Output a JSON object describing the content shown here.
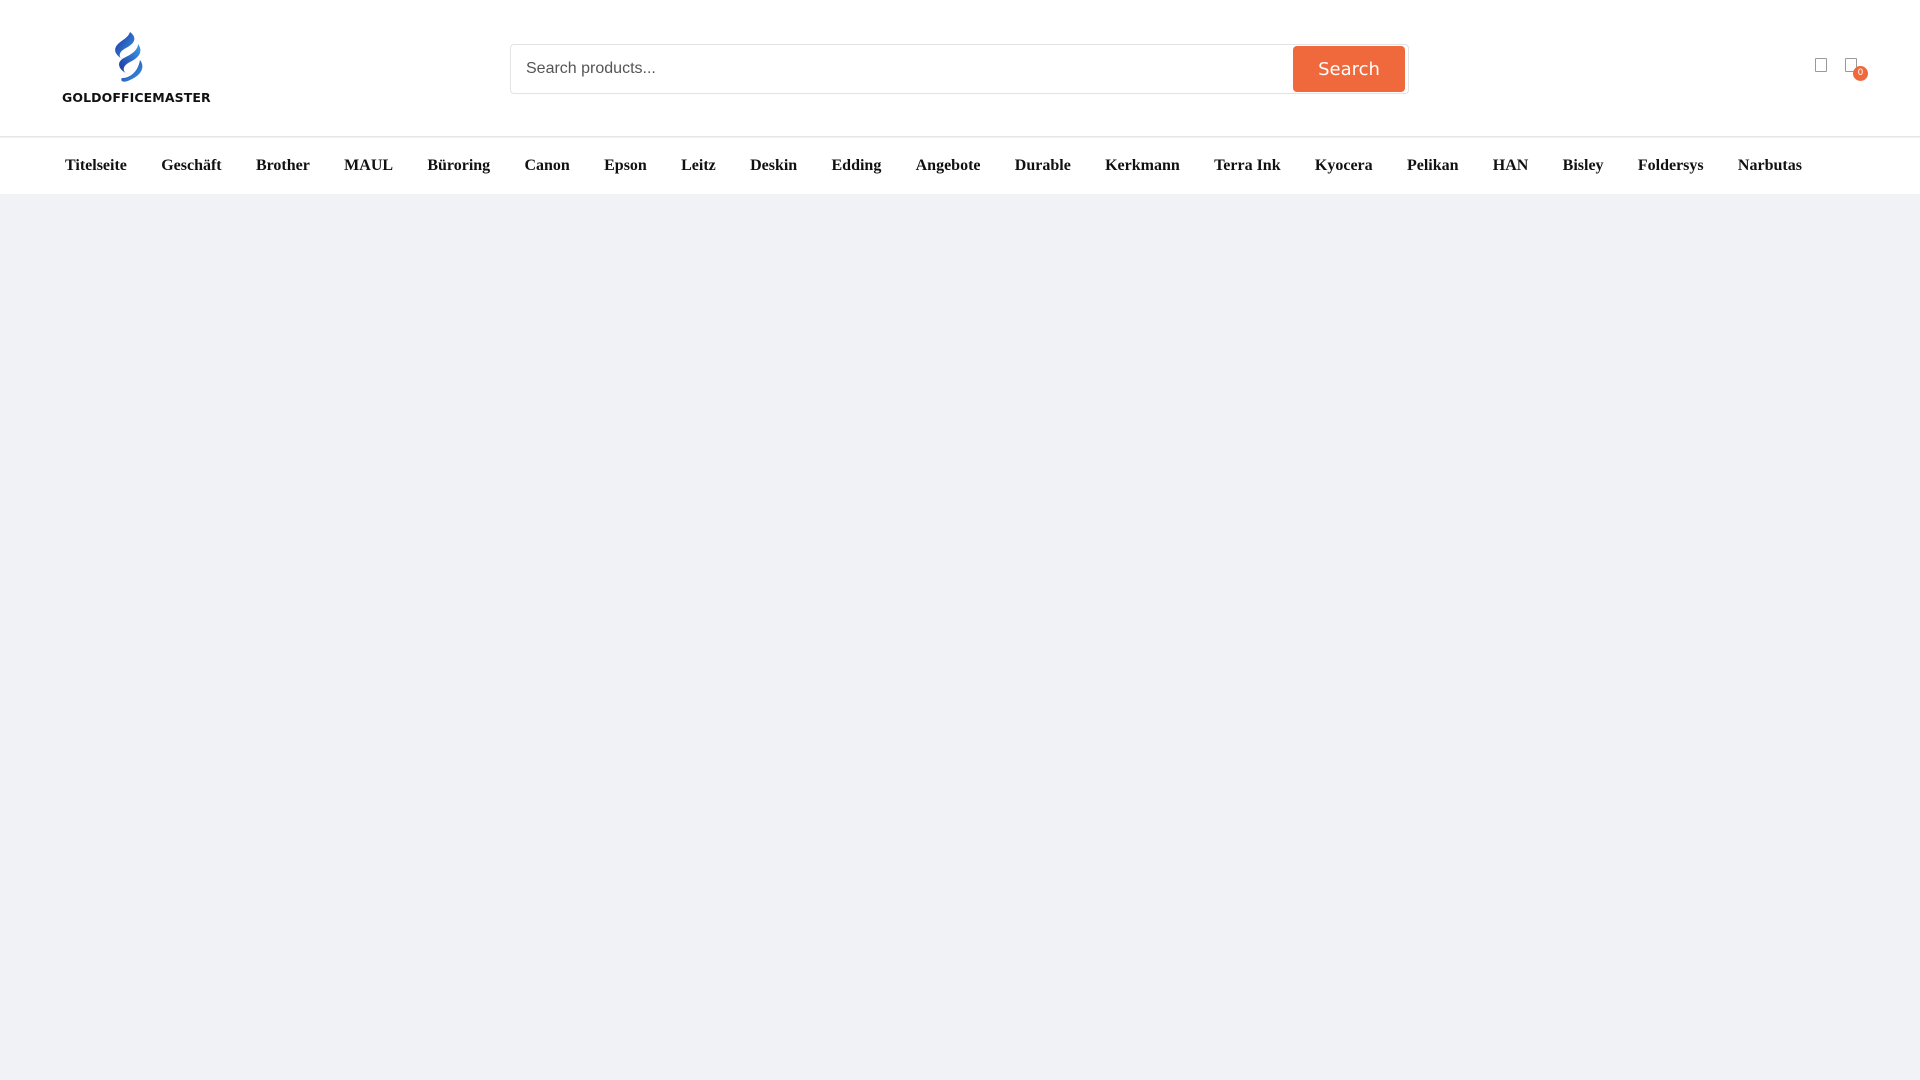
{
  "brand": {
    "name": "GOLDOFFICEMASTER",
    "logo_icon": "flame-swirl-logo",
    "colors": {
      "logo_dark": "#1f2fa0",
      "logo_light": "#3aa0e8"
    }
  },
  "search": {
    "placeholder": "Search products...",
    "value": "",
    "button_label": "Search",
    "button_color": "#f0693c"
  },
  "header_icons": {
    "account_icon": "user-icon",
    "cart_icon": "cart-icon",
    "cart_count": "0"
  },
  "nav": {
    "items": [
      {
        "label": "Titelseite"
      },
      {
        "label": "Geschäft"
      },
      {
        "label": "Brother"
      },
      {
        "label": "MAUL"
      },
      {
        "label": "Büroring"
      },
      {
        "label": "Canon"
      },
      {
        "label": "Epson"
      },
      {
        "label": "Leitz"
      },
      {
        "label": "Deskin"
      },
      {
        "label": "Edding"
      },
      {
        "label": "Angebote"
      },
      {
        "label": "Durable"
      },
      {
        "label": "Kerkmann"
      },
      {
        "label": "Terra Ink"
      },
      {
        "label": "Kyocera"
      },
      {
        "label": "Pelikan"
      },
      {
        "label": "HAN"
      },
      {
        "label": "Bisley"
      },
      {
        "label": "Foldersys"
      },
      {
        "label": "Narbutas"
      }
    ]
  }
}
